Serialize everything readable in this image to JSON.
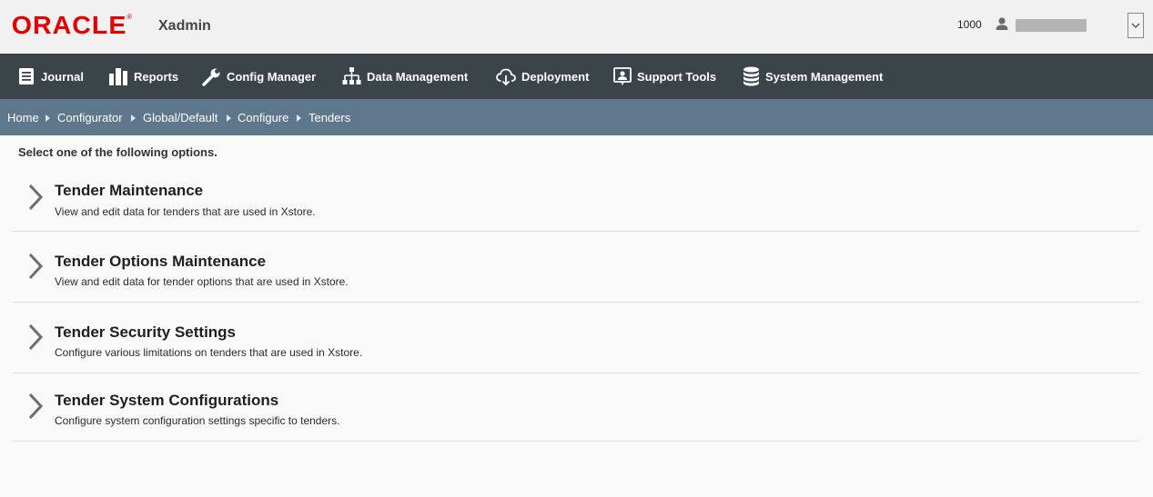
{
  "header": {
    "brand": "ORACLE",
    "brand_mark": "®",
    "app_name": "Xadmin",
    "store_number": "1000",
    "user_name": "",
    "user_icon": "user-icon",
    "dropdown_icon": "chevron-down-icon"
  },
  "nav": {
    "items": [
      {
        "label": "Journal",
        "icon": "journal-icon"
      },
      {
        "label": "Reports",
        "icon": "bar-chart-icon"
      },
      {
        "label": "Config Manager",
        "icon": "wrench-icon"
      },
      {
        "label": "Data Management",
        "icon": "hierarchy-icon"
      },
      {
        "label": "Deployment",
        "icon": "cloud-download-icon"
      },
      {
        "label": "Support Tools",
        "icon": "support-icon"
      },
      {
        "label": "System Management",
        "icon": "database-icon"
      }
    ]
  },
  "breadcrumb": {
    "items": [
      "Home",
      "Configurator",
      "Global/Default",
      "Configure",
      "Tenders"
    ]
  },
  "main": {
    "intro": "Select one of the following options.",
    "options": [
      {
        "title": "Tender Maintenance",
        "description": "View and edit data for tenders that are used in Xstore."
      },
      {
        "title": "Tender Options Maintenance",
        "description": "View and edit data for tender options that are used in Xstore."
      },
      {
        "title": "Tender Security Settings",
        "description": "Configure various limitations on tenders that are used in Xstore."
      },
      {
        "title": "Tender System Configurations",
        "description": "Configure system configuration settings specific to tenders."
      }
    ]
  }
}
